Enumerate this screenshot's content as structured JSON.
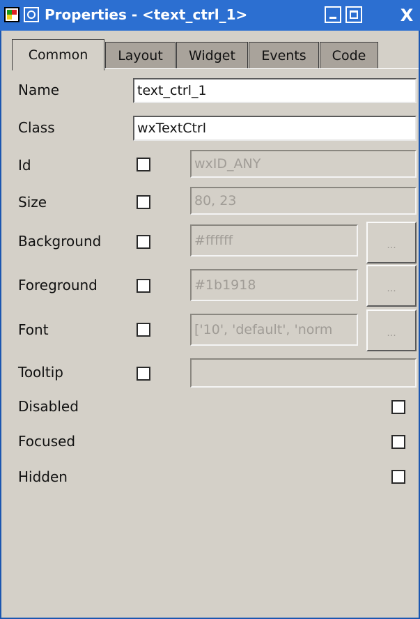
{
  "window": {
    "title": "Properties - <text_ctrl_1>",
    "close_glyph": "X"
  },
  "tabs": [
    {
      "label": "Common",
      "active": true
    },
    {
      "label": "Layout",
      "active": false
    },
    {
      "label": "Widget",
      "active": false
    },
    {
      "label": "Events",
      "active": false
    },
    {
      "label": "Code",
      "active": false
    }
  ],
  "fields": {
    "name": {
      "label": "Name",
      "value": "text_ctrl_1"
    },
    "class": {
      "label": "Class",
      "value": "wxTextCtrl"
    },
    "id": {
      "label": "Id",
      "value": "wxID_ANY",
      "checked": false
    },
    "size": {
      "label": "Size",
      "value": "80, 23",
      "checked": false
    },
    "background": {
      "label": "Background",
      "value": "#ffffff",
      "checked": false,
      "button_label": "..."
    },
    "foreground": {
      "label": "Foreground",
      "value": "#1b1918",
      "checked": false,
      "button_label": "..."
    },
    "font": {
      "label": "Font",
      "value": "['10', 'default', 'norm",
      "checked": false,
      "button_label": "..."
    },
    "tooltip": {
      "label": "Tooltip",
      "value": "",
      "checked": false
    }
  },
  "flags": {
    "disabled": {
      "label": "Disabled",
      "checked": false
    },
    "focused": {
      "label": "Focused",
      "checked": false
    },
    "hidden": {
      "label": "Hidden",
      "checked": false
    }
  },
  "colors": {
    "titlebar": "#2c6fd1",
    "window_bg": "#d4d0c8",
    "tab_inactive": "#a9a39b",
    "disabled_text": "#a09c96"
  },
  "icons": {
    "app": "wxglade-app-icon",
    "window_menu": "window-menu-icon",
    "minimize": "minimize-icon",
    "maximize": "maximize-icon",
    "close": "close-icon"
  }
}
